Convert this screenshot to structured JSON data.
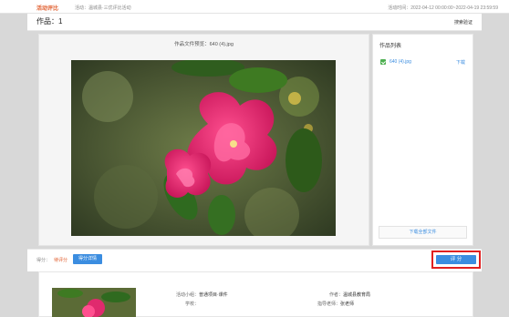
{
  "topbar": {
    "brand": "活动评比",
    "activity": "活动：温城县·三优评比活动",
    "time": "活动时间：2022-04-12 00:00:00~2022-04-19 23:59:59"
  },
  "header": {
    "title": "作品：1",
    "search_link": "搜索验证"
  },
  "viewer": {
    "preview_title": "作品文件预览：640 (4).jpg"
  },
  "file_list": {
    "title": "作品列表",
    "files": [
      {
        "name": "640 (4).jpg",
        "download": "下载"
      }
    ],
    "download_all": "下载全部文件"
  },
  "score": {
    "label": "得分：",
    "pending": "待评分",
    "detail_button": "得分详情",
    "rate_button": "评 分"
  },
  "details": {
    "category_label": "活动小组：",
    "category_value": "普通项目·课件",
    "school_label": "学校：",
    "school_value": "",
    "author_label": "作者：",
    "author_value": "温城县教育局",
    "teacher_label": "指导老师：",
    "teacher_value": "张老师"
  },
  "colors": {
    "accent": "#3b8de0",
    "brand": "#e05c2b",
    "highlight": "#e02020"
  }
}
